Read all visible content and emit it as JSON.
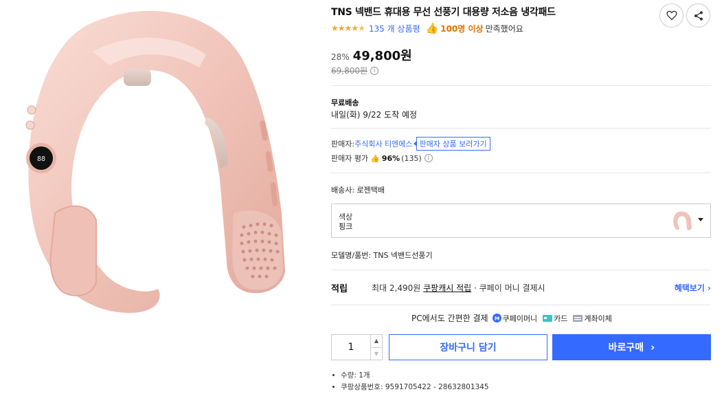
{
  "product": {
    "title": "TNS 넥밴드 휴대용 무선 선풍기 대용량 저소음 냉각패드",
    "image_alt": "핑크 넥밴드 선풍기"
  },
  "actions": {
    "wishlist_icon": "heart-icon",
    "share_icon": "share-icon"
  },
  "rating": {
    "stars": 4.5,
    "review_count": "135 개 상품평",
    "thumb_icon": "thumbs-up-icon",
    "satisfied_count": "100명 이상",
    "satisfied_text": "만족했어요"
  },
  "price": {
    "discount": "28%",
    "sale": "49,800원",
    "original": "69,800원",
    "info_icon": "info-icon"
  },
  "shipping": {
    "title": "무료배송",
    "arrival": "내일(화) 9/22 도착 예정"
  },
  "seller": {
    "label": "판매자: ",
    "name": "주식회사 티엔에스",
    "products_link": "판매자 상품 보러가기",
    "rating_label": "판매자 평가",
    "rating_pct": "96%",
    "rating_count": "(135)"
  },
  "carrier": {
    "text": "배송사:  로젠택배"
  },
  "option": {
    "label": "색상",
    "value": "핑크"
  },
  "model": {
    "text": "모델명/품번:  TNS 넥밴드선풍기"
  },
  "reward": {
    "title": "적립",
    "prefix": "최대 2,490원",
    "cash": "쿠팡캐시 적립",
    "suffix": "· 쿠페이 머니 결제시",
    "link": "혜택보기"
  },
  "payment": {
    "label": "PC에서도 간편한 결제",
    "methods": [
      {
        "icon": "coupay-icon",
        "label": "쿠페이머니"
      },
      {
        "icon": "card-icon",
        "label": "카드"
      },
      {
        "icon": "bank-transfer-icon",
        "label": "계좌이체"
      }
    ]
  },
  "purchase": {
    "quantity": "1",
    "cart_label": "장바구니 담기",
    "buy_label": "바로구매",
    "buy_icon": "chevron-right-icon"
  },
  "details": [
    "수량: 1개",
    "쿠팡상품번호: 9591705422 - 28632801345"
  ],
  "colors": {
    "accent": "#346aff",
    "star": "#f5a623",
    "satisfied": "#e46f00",
    "product_pink": "#f2c9c0"
  }
}
